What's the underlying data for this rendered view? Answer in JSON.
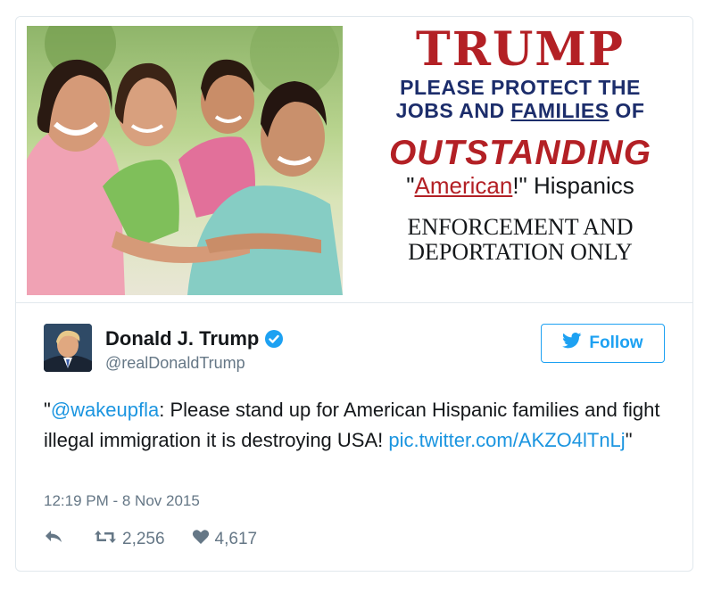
{
  "media": {
    "title": "TRUMP",
    "line1": "PLEASE PROTECT THE",
    "line2_pre": "JOBS AND ",
    "line2_underlined": "FAMILIES",
    "line2_post": " OF",
    "outstanding": "OUTSTANDING",
    "hispanics_pre": "\"",
    "hispanics_american": "American",
    "hispanics_post": "!\" Hispanics",
    "enforcement_line1": "ENFORCEMENT AND",
    "enforcement_line2": "DEPORTATION ONLY"
  },
  "author": {
    "name": "Donald J. Trump",
    "handle": "@realDonaldTrump",
    "verified_icon": "verified-badge-icon"
  },
  "follow": {
    "label": "Follow",
    "icon": "twitter-bird-icon"
  },
  "tweet": {
    "open_quote": "\"",
    "mention": "@wakeupfla",
    "text": ": Please stand up for American Hispanic families and fight illegal immigration it is destroying USA! ",
    "link": "pic.twitter.com/AKZO4lTnLj",
    "close_quote": "\""
  },
  "timestamp": "12:19 PM - 8 Nov 2015",
  "actions": {
    "reply_icon": "reply-icon",
    "retweet_icon": "retweet-icon",
    "retweet_count": "2,256",
    "like_icon": "heart-icon",
    "like_count": "4,617"
  },
  "colors": {
    "accent": "#1da1f2",
    "link": "#1b95e0",
    "ad_red": "#b32025",
    "ad_navy": "#1c2d6b",
    "muted": "#657786"
  }
}
